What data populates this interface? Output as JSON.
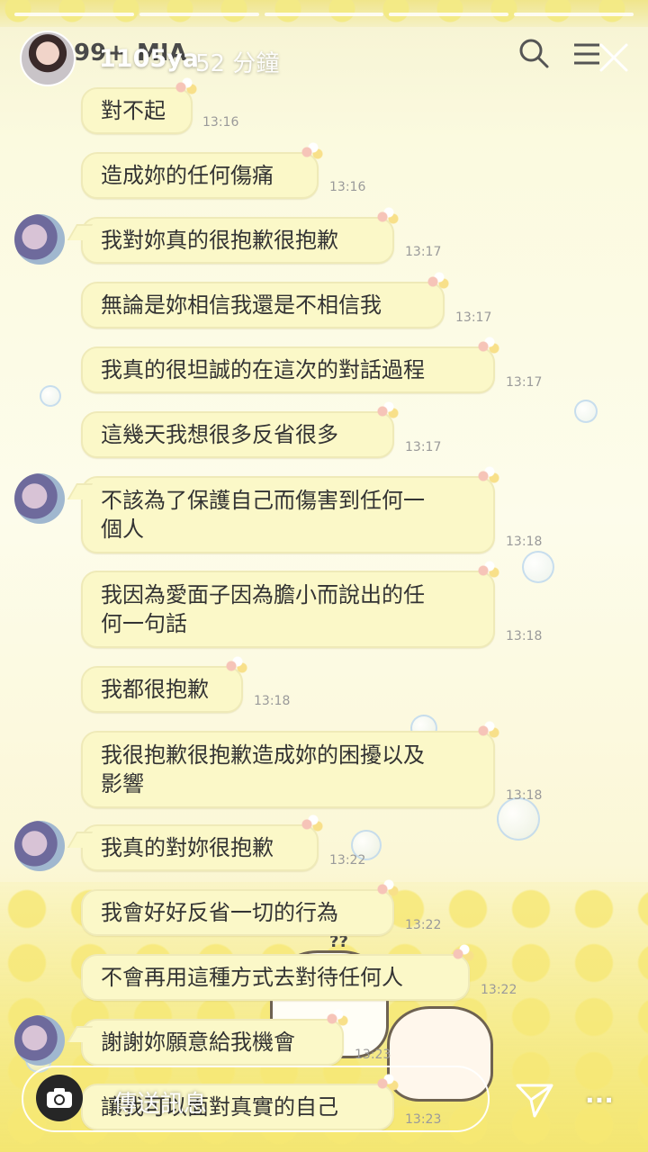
{
  "story": {
    "progress_segments": 5,
    "under_handle_prefix": "99+",
    "under_handle_name": "MIA",
    "username": "1105ya",
    "time_ago": "52 分鐘"
  },
  "messages": [
    {
      "text": "對不起",
      "time": "13:16"
    },
    {
      "text": "造成妳的任何傷痛",
      "time": "13:16"
    },
    {
      "text": "我對妳真的很抱歉很抱歉",
      "time": "13:17"
    },
    {
      "text": "無論是妳相信我還是不相信我",
      "time": "13:17"
    },
    {
      "text": "我真的很坦誠的在這次的對話過程",
      "time": "13:17"
    },
    {
      "text": "這幾天我想很多反省很多",
      "time": "13:17"
    },
    {
      "text": "不該為了保護自己而傷害到任何一\n個人",
      "time": "13:18"
    },
    {
      "text": "我因為愛面子因為膽小而說出的任\n何一句話",
      "time": "13:18"
    },
    {
      "text": "我都很抱歉",
      "time": "13:18"
    },
    {
      "text": "我很抱歉很抱歉造成妳的困擾以及\n影響",
      "time": "13:18"
    },
    {
      "text": "我真的對妳很抱歉",
      "time": "13:22"
    },
    {
      "text": "我會好好反省一切的行為",
      "time": "13:22"
    },
    {
      "text": "不會再用這種方式去對待任何人",
      "time": "13:22"
    },
    {
      "text": "謝謝妳願意給我機會",
      "time": "13:23"
    },
    {
      "text": "讓我可以面對真實的自己",
      "time": "13:23"
    }
  ],
  "cat_mark": "??",
  "reply": {
    "placeholder": "傳送訊息"
  },
  "icons": {
    "search": "search-icon",
    "menu": "menu-icon",
    "close": "close-icon",
    "camera": "camera-icon",
    "send": "send-icon",
    "more": "more-icon"
  }
}
